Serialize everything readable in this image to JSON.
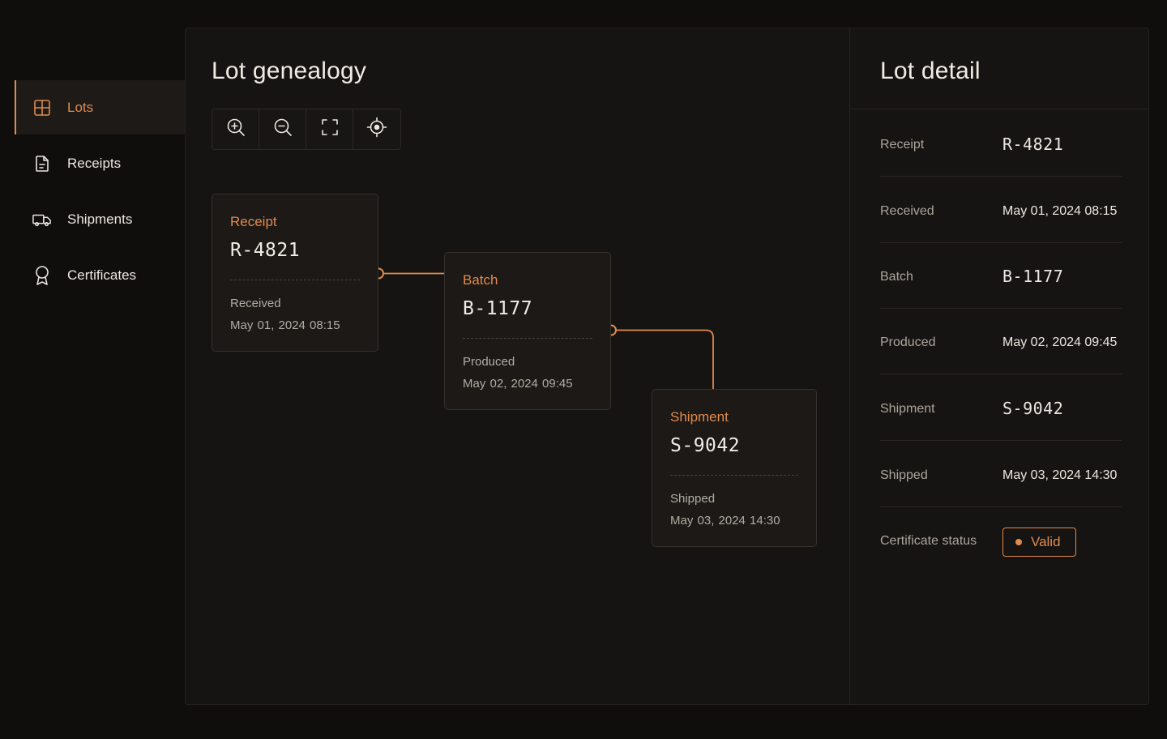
{
  "theme": {
    "accent": "#e08a4e",
    "background": "#0f0e0d",
    "panel": "#161412"
  },
  "sidebar": {
    "items": [
      {
        "label": "Lots",
        "icon": "grid-icon",
        "active": true
      },
      {
        "label": "Receipts",
        "icon": "document-icon",
        "active": false
      },
      {
        "label": "Shipments",
        "icon": "truck-icon",
        "active": false
      },
      {
        "label": "Certificates",
        "icon": "award-icon",
        "active": false
      }
    ]
  },
  "genealogy": {
    "title": "Lot genealogy",
    "toolbar": [
      "zoom-in-icon",
      "zoom-out-icon",
      "fit-screen-icon",
      "locate-icon"
    ],
    "nodes": [
      {
        "type": "Receipt",
        "code": "R-4821",
        "meta_label": "Received",
        "meta_value": "May 01, 2024  08:15"
      },
      {
        "type": "Batch",
        "code": "B-1177",
        "meta_label": "Produced",
        "meta_value": "May 02, 2024  09:45"
      },
      {
        "type": "Shipment",
        "code": "S-9042",
        "meta_label": "Shipped",
        "meta_value": "May 03, 2024  14:30"
      }
    ]
  },
  "detail": {
    "title": "Lot detail",
    "rows": [
      {
        "label": "Receipt",
        "value": "R-4821"
      },
      {
        "label": "Received",
        "value": "May 01, 2024 08:15"
      },
      {
        "label": "Batch",
        "value": "B-1177"
      },
      {
        "label": "Produced",
        "value": "May 02, 2024 09:45"
      },
      {
        "label": "Shipment",
        "value": "S-9042"
      },
      {
        "label": "Shipped",
        "value": "May 03, 2024 14:30"
      }
    ],
    "certificate_label": "Certificate status",
    "certificate_status": "Valid"
  }
}
